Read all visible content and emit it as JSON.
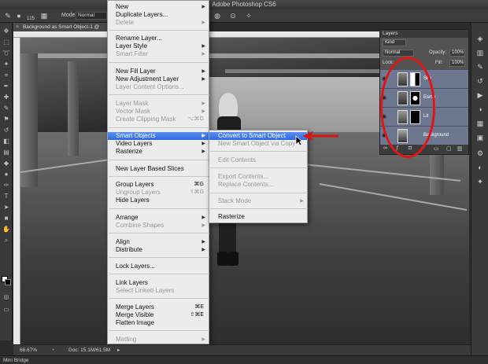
{
  "window": {
    "title": "Adobe Photoshop CS6"
  },
  "options_bar": {
    "size_value": "125",
    "mode_label": "Mode:",
    "mode_value": "Normal"
  },
  "document": {
    "tab_title": "Background as Smart Object-1 @",
    "zoom": "66.67%",
    "doc_info": "Doc: 15.1M/61.5M"
  },
  "menu": {
    "items": [
      {
        "label": "New",
        "enabled": true,
        "submenu": true
      },
      {
        "label": "Duplicate Layers...",
        "enabled": true
      },
      {
        "label": "Delete",
        "enabled": false,
        "submenu": true
      },
      {
        "label": "Rename Layer...",
        "enabled": true
      },
      {
        "label": "Layer Style",
        "enabled": true,
        "submenu": true
      },
      {
        "label": "Smart Filter",
        "enabled": false,
        "submenu": true
      },
      {
        "label": "New Fill Layer",
        "enabled": true,
        "submenu": true
      },
      {
        "label": "New Adjustment Layer",
        "enabled": true,
        "submenu": true
      },
      {
        "label": "Layer Content Options...",
        "enabled": false
      },
      {
        "label": "Layer Mask",
        "enabled": false,
        "submenu": true
      },
      {
        "label": "Vector Mask",
        "enabled": false,
        "submenu": true
      },
      {
        "label": "Create Clipping Mask",
        "enabled": false,
        "shortcut": "⌥⌘G"
      },
      {
        "label": "Smart Objects",
        "enabled": true,
        "submenu": true,
        "highlighted": true
      },
      {
        "label": "Video Layers",
        "enabled": true,
        "submenu": true
      },
      {
        "label": "Rasterize",
        "enabled": true,
        "submenu": true
      },
      {
        "label": "New Layer Based Slices",
        "enabled": true
      },
      {
        "label": "Group Layers",
        "enabled": true,
        "shortcut": "⌘G"
      },
      {
        "label": "Ungroup Layers",
        "enabled": false,
        "shortcut": "⇧⌘G"
      },
      {
        "label": "Hide Layers",
        "enabled": true
      },
      {
        "label": "Arrange",
        "enabled": true,
        "submenu": true
      },
      {
        "label": "Combine Shapes",
        "enabled": false,
        "submenu": true
      },
      {
        "label": "Align",
        "enabled": true,
        "submenu": true
      },
      {
        "label": "Distribute",
        "enabled": true,
        "submenu": true
      },
      {
        "label": "Lock Layers...",
        "enabled": true
      },
      {
        "label": "Link Layers",
        "enabled": true
      },
      {
        "label": "Select Linked Layers",
        "enabled": false
      },
      {
        "label": "Merge Layers",
        "enabled": true,
        "shortcut": "⌘E"
      },
      {
        "label": "Merge Visible",
        "enabled": true,
        "shortcut": "⇧⌘E"
      },
      {
        "label": "Flatten Image",
        "enabled": true
      },
      {
        "label": "Matting",
        "enabled": false,
        "submenu": true
      }
    ]
  },
  "submenu": {
    "items": [
      {
        "label": "Convert to Smart Object",
        "enabled": true,
        "highlighted": true
      },
      {
        "label": "New Smart Object via Copy",
        "enabled": false
      },
      {
        "label": "Edit Contents",
        "enabled": false
      },
      {
        "label": "Export Contents...",
        "enabled": false
      },
      {
        "label": "Replace Contents...",
        "enabled": false
      },
      {
        "label": "Stack Mode",
        "enabled": false,
        "submenu": true
      },
      {
        "label": "Rasterize",
        "enabled": true
      }
    ]
  },
  "layers_panel": {
    "tab": "Layers",
    "filter_kind": "Kind",
    "blend_mode": "Normal",
    "opacity_label": "Opacity:",
    "opacity_value": "100%",
    "lock_label": "Lock:",
    "fill_label": "Fill:",
    "fill_value": "100%",
    "layers": [
      {
        "name": "Sky"
      },
      {
        "name": "Esme"
      },
      {
        "name": "Lit"
      },
      {
        "name": "Background"
      }
    ]
  },
  "bottom_panel": {
    "label": "Mini Bridge"
  }
}
